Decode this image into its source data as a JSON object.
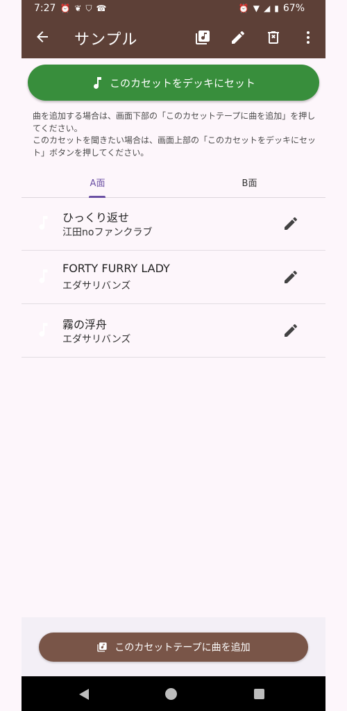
{
  "status_bar": {
    "time": "7:27",
    "battery": "67%"
  },
  "app_bar": {
    "title": "サンプル",
    "icons": [
      "back-arrow-icon",
      "music-library-icon",
      "edit-pencil-icon",
      "delete-icon",
      "more-vert-icon"
    ]
  },
  "set_button": {
    "label": "このカセットをデッキにセット",
    "icon": "music-note-icon",
    "color": "#388e3c"
  },
  "info": {
    "line1": "曲を追加する場合は、画面下部の「このカセットテープに曲を追加」を押してください。",
    "line2": "このカセットを聞きたい場合は、画面上部の「このカセットをデッキにセット」ボタンを押してください。"
  },
  "tabs": [
    {
      "label": "A面",
      "active": true
    },
    {
      "label": "B面",
      "active": false
    }
  ],
  "tracks": [
    {
      "title": "ひっくり返せ",
      "artist": "江田noファンクラブ"
    },
    {
      "title": "FORTY FURRY LADY",
      "artist": "エダサリバンズ"
    },
    {
      "title": "霧の浮舟",
      "artist": "エダサリバンズ"
    }
  ],
  "add_button": {
    "label": "このカセットテープに曲を追加",
    "icon": "add-music-icon",
    "color": "#795548"
  },
  "theme": {
    "app_bar": "#5d4037",
    "accent": "#6a4fa3",
    "background": "#fdf6fb"
  }
}
